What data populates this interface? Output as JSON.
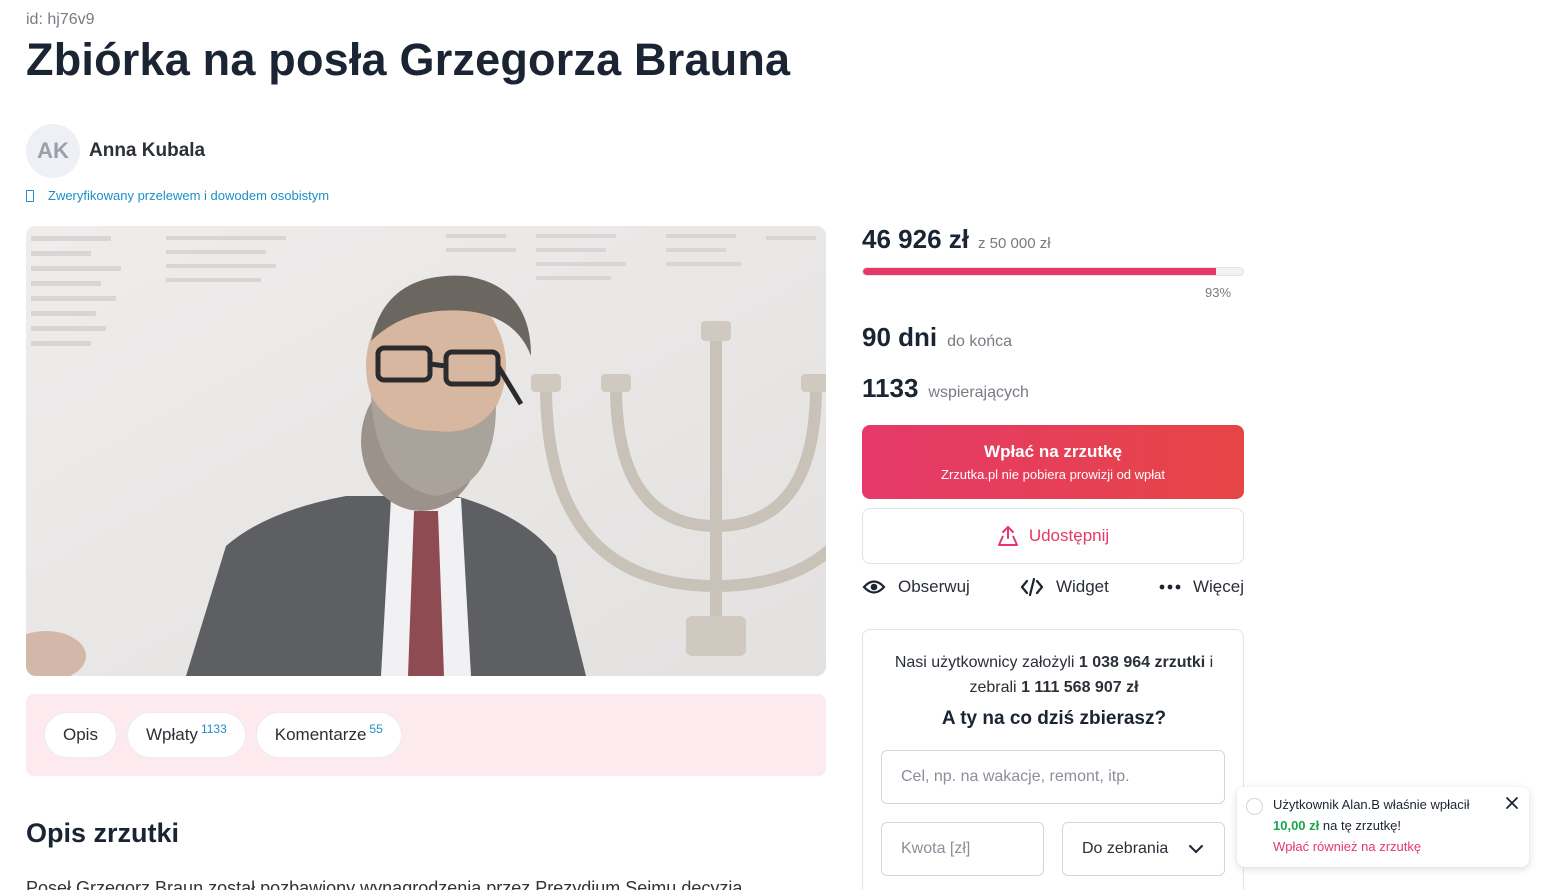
{
  "page": {
    "id_label": "id: hj76v9",
    "title": "Zbiórka na posła Grzegorza Brauna"
  },
  "author": {
    "initials": "AK",
    "name": "Anna Kubala",
    "verified_text": "Zweryfikowany przelewem i dowodem osobistym"
  },
  "tabs": [
    {
      "label": "Opis",
      "count": ""
    },
    {
      "label": "Wpłaty",
      "count": "1133"
    },
    {
      "label": "Komentarze",
      "count": "55"
    }
  ],
  "section": {
    "title": "Opis zrzutki",
    "clipped_text": "Poseł Grzegorz Braun został pozbawiony wynagrodzenia przez Prezydium Sejmu decyzją nałożenia"
  },
  "stats": {
    "raised": "46 926 zł",
    "goal": "z 50 000 zł",
    "progress_fraction": 0.93,
    "progress_label": "93%",
    "days_value": "90 dni",
    "days_label": "do końca",
    "supporters_value": "1133",
    "supporters_label": "wspierających"
  },
  "buttons": {
    "donate_main": "Wpłać na zrzutkę",
    "donate_sub": "Zrzutka.pl nie pobiera prowizji od wpłat",
    "share": "Udostępnij",
    "follow": "Obserwuj",
    "widget": "Widget",
    "more": "Więcej"
  },
  "promo": {
    "text_prefix": "Nasi użytkownicy założyli",
    "count_zrzutki": "1 038 964 zrzutki",
    "text_mid": "i zebrali",
    "total_amount": "1 111 568 907 zł",
    "question": "A ty na co dziś zbierasz?",
    "goal_placeholder": "Cel, np. na wakacje, remont, itp.",
    "amount_placeholder": "Kwota [zł]",
    "select_value": "Do zebrania"
  },
  "toast": {
    "line1": "Użytkownik Alan.B właśnie wpłacił",
    "amount": "10,00 zł",
    "line2_suffix": "na tę zrzutkę!",
    "cta": "Wpłać również na zrzutkę"
  },
  "colors": {
    "accent": "#e6396a",
    "link": "#1d8fc4",
    "tabs_bg": "#fceaee",
    "success": "#1aa64a"
  },
  "icons": {
    "verified": "id-card-icon",
    "share": "share-icon",
    "follow": "eye-icon",
    "widget": "code-icon",
    "more": "dots-icon",
    "select": "chevron-down-icon",
    "close": "close-icon"
  }
}
